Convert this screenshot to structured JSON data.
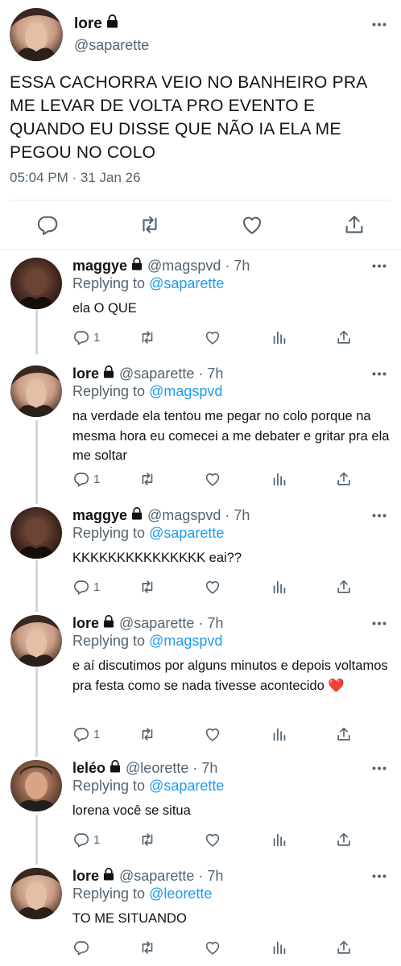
{
  "main_tweet": {
    "name": "lore",
    "handle": "@saparette",
    "text": "ESSA CACHORRA VEIO NO BANHEIRO PRA ME LEVAR DE VOLTA PRO EVENTO E QUANDO EU DISSE QUE NÃO IA ELA ME PEGOU NO COLO",
    "timestamp": "05:04 PM · 31 Jan 26",
    "actions": [
      "reply-icon",
      "retweet-icon",
      "like-icon",
      "share-icon"
    ]
  },
  "replies": [
    {
      "name": "maggye",
      "handle": "@magspvd",
      "time": "7h",
      "replying_label": "Replying to",
      "replying_to": "@saparette",
      "text": "ela O QUE",
      "reply_count": "1"
    },
    {
      "name": "lore",
      "handle": "@saparette",
      "time": "7h",
      "replying_label": "Replying to",
      "replying_to": "@magspvd",
      "text": "na verdade ela tentou me pegar no colo porque na mesma hora eu comecei a me debater e gritar pra ela me soltar",
      "reply_count": "1"
    },
    {
      "name": "maggye",
      "handle": "@magspvd",
      "time": "7h",
      "replying_label": "Replying to",
      "replying_to": "@saparette",
      "text": "KKKKKKKKKKKKKKK eai??",
      "reply_count": "1"
    },
    {
      "name": "lore",
      "handle": "@saparette",
      "time": "7h",
      "replying_label": "Replying to",
      "replying_to": "@magspvd",
      "text": "e aí discutimos por alguns minutos e depois voltamos pra festa como se nada tivesse acontecido ❤️",
      "reply_count": "1"
    },
    {
      "name": "leléo",
      "handle": "@leorette",
      "time": "7h",
      "replying_label": "Replying to",
      "replying_to": "@saparette",
      "text": "lorena você se situa",
      "reply_count": "1"
    },
    {
      "name": "lore",
      "handle": "@saparette",
      "time": "7h",
      "replying_label": "Replying to",
      "replying_to": "@leorette",
      "text": "TO ME SITUANDO",
      "reply_count": ""
    }
  ],
  "colors": {
    "accent": "#1d9bf0",
    "secondary_text": "#536471",
    "divider": "#e6ecf0",
    "thread_line": "#cfd9de"
  }
}
